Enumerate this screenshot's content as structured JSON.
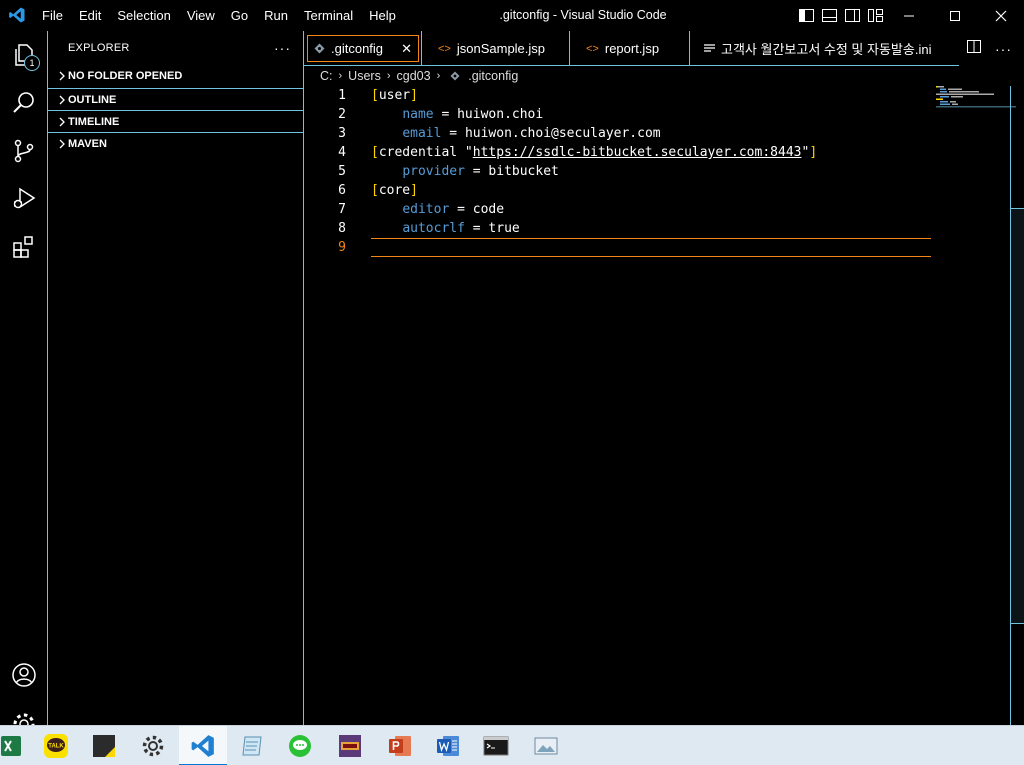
{
  "titlebar": {
    "menu": [
      "File",
      "Edit",
      "Selection",
      "View",
      "Go",
      "Run",
      "Terminal",
      "Help"
    ],
    "window_title": ".gitconfig - Visual Studio Code"
  },
  "activity_bar": {
    "explorer_badge": "1",
    "accent_color": "#6fc3df"
  },
  "sidebar": {
    "title": "EXPLORER",
    "more": "···",
    "sections": [
      "NO FOLDER OPENED",
      "OUTLINE",
      "TIMELINE",
      "MAVEN"
    ]
  },
  "tabs": [
    {
      "label": ".gitconfig",
      "icon": "gear-file-icon",
      "active": true,
      "close": "✕"
    },
    {
      "label": "jsonSample.jsp",
      "icon": "code-file-icon",
      "active": false
    },
    {
      "label": "report.jsp",
      "icon": "code-file-icon",
      "active": false
    },
    {
      "label": "고객사 월간보고서 수정 및 자동발송.ini",
      "icon": "lines-file-icon",
      "active": false
    }
  ],
  "tab_actions": {
    "more": "···"
  },
  "breadcrumb": [
    "C:",
    "Users",
    "cgd03",
    ".gitconfig"
  ],
  "editor": {
    "line_numbers": [
      "1",
      "2",
      "3",
      "4",
      "5",
      "6",
      "7",
      "8",
      "9"
    ],
    "current_line": 9,
    "lines": [
      {
        "indent": "",
        "section": "user"
      },
      {
        "indent": "    ",
        "key": "name",
        "value": "huiwon.choi"
      },
      {
        "indent": "    ",
        "key": "email",
        "value": "huiwon.choi@seculayer.com"
      },
      {
        "indent": "",
        "section_prefix": "credential \"",
        "url": "https://ssdlc-bitbucket.seculayer.com:8443",
        "section_suffix": "\""
      },
      {
        "indent": "    ",
        "key": "provider",
        "value": "bitbucket"
      },
      {
        "indent": "",
        "section": "core"
      },
      {
        "indent": "    ",
        "key": "editor",
        "value": "code"
      },
      {
        "indent": "    ",
        "key": "autocrlf",
        "value": "true"
      },
      {
        "indent": "",
        "text": ""
      }
    ],
    "key_color": "#569cd6",
    "bracket_color": "#ffd700",
    "cursor_line_color": "#f38518"
  },
  "taskbar": {
    "items": [
      "excel-icon",
      "kakaotalk-icon",
      "sticky-notes-icon",
      "settings-icon",
      "vscode-icon",
      "notepad-icon",
      "line-icon",
      "app-icon",
      "powerpoint-icon",
      "word-icon",
      "terminal-icon",
      "photos-icon"
    ],
    "kakao_label": "TALK",
    "active_index": 4
  }
}
